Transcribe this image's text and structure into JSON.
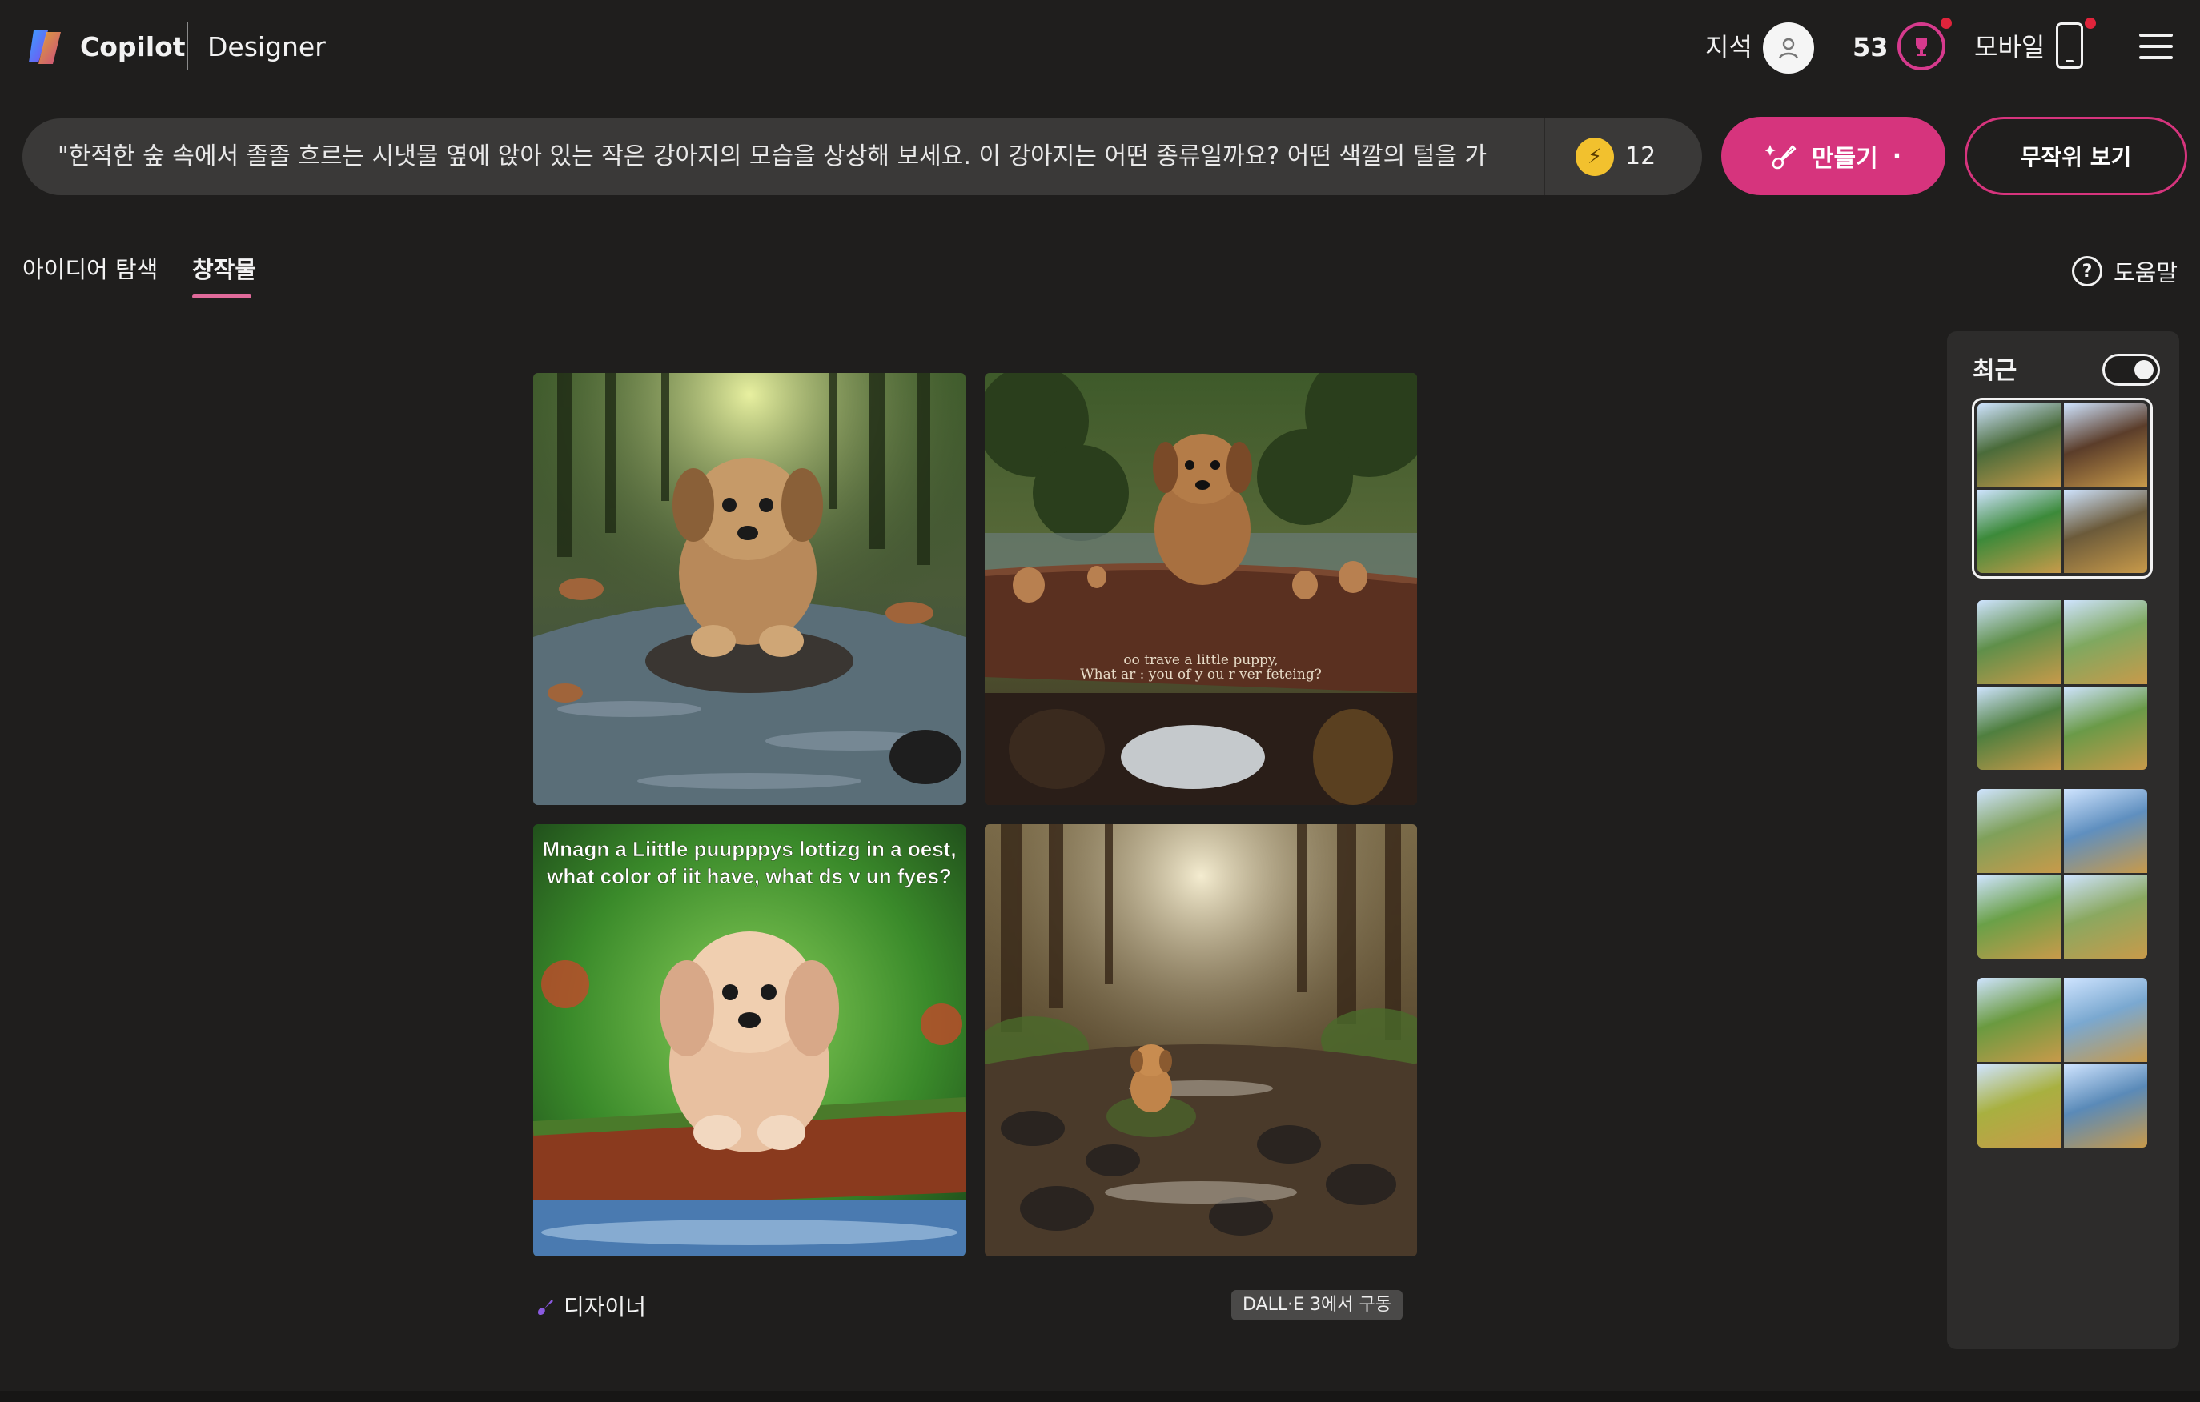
{
  "header": {
    "brand": "Copilot",
    "product": "Designer",
    "user_label": "지석",
    "reward_count": "53",
    "mobile_label": "모바일"
  },
  "prompt": {
    "text": "\"한적한 숲 속에서 졸졸 흐르는 시냇물 옆에 앉아 있는 작은 강아지의 모습을 상상해 보세요. 이 강아지는 어떤 종류일까요? 어떤 색깔의 털을 가",
    "boost_count": "12",
    "create_label": "만들기",
    "random_label": "무작위 보기"
  },
  "tabs": {
    "explore": "아이디어 탐색",
    "creations": "창작물",
    "help": "도움말"
  },
  "gallery": {
    "images": [
      {
        "name": "puppy-on-rock-in-forest-stream",
        "caption": ""
      },
      {
        "name": "puppy-on-log-with-small-puppies",
        "caption": "oo trave a  little puppy,|What ar : you of y ou r ver feteing?"
      },
      {
        "name": "fluffy-puppy-on-mossy-log",
        "caption": "Mnagn a Liittle puupppys lottizg in a oest,|what color of iit have, what ds v un fyes?"
      },
      {
        "name": "puppy-on-moss-stone-in-sunlit-forest",
        "caption": ""
      }
    ],
    "footer_brand": "디자이너",
    "powered_by": "DALL·E 3에서 구동"
  },
  "recent_panel": {
    "title": "최근",
    "toggle_on": true,
    "sets": [
      {
        "name": "forest-puppy-set",
        "selected": true,
        "colors": [
          "#4a6b3a",
          "#5b3d2a",
          "#3c8a3a",
          "#6b5a3a"
        ]
      },
      {
        "name": "golden-retriever-frisbee-set-1",
        "selected": false,
        "colors": [
          "#5f8f4a",
          "#7fa860",
          "#4f7f3f",
          "#6a9a48"
        ]
      },
      {
        "name": "golden-retriever-frisbee-set-2",
        "selected": false,
        "colors": [
          "#7fa05a",
          "#5f8fbf",
          "#6aa048",
          "#8aa860"
        ]
      },
      {
        "name": "golden-retriever-frisbee-set-3",
        "selected": false,
        "colors": [
          "#6a9a40",
          "#7aa8d0",
          "#a8b040",
          "#5a8ab8"
        ]
      }
    ]
  },
  "colors": {
    "accent": "#d6347d",
    "background": "#1f1e1d",
    "panel": "#2d2c2b"
  }
}
